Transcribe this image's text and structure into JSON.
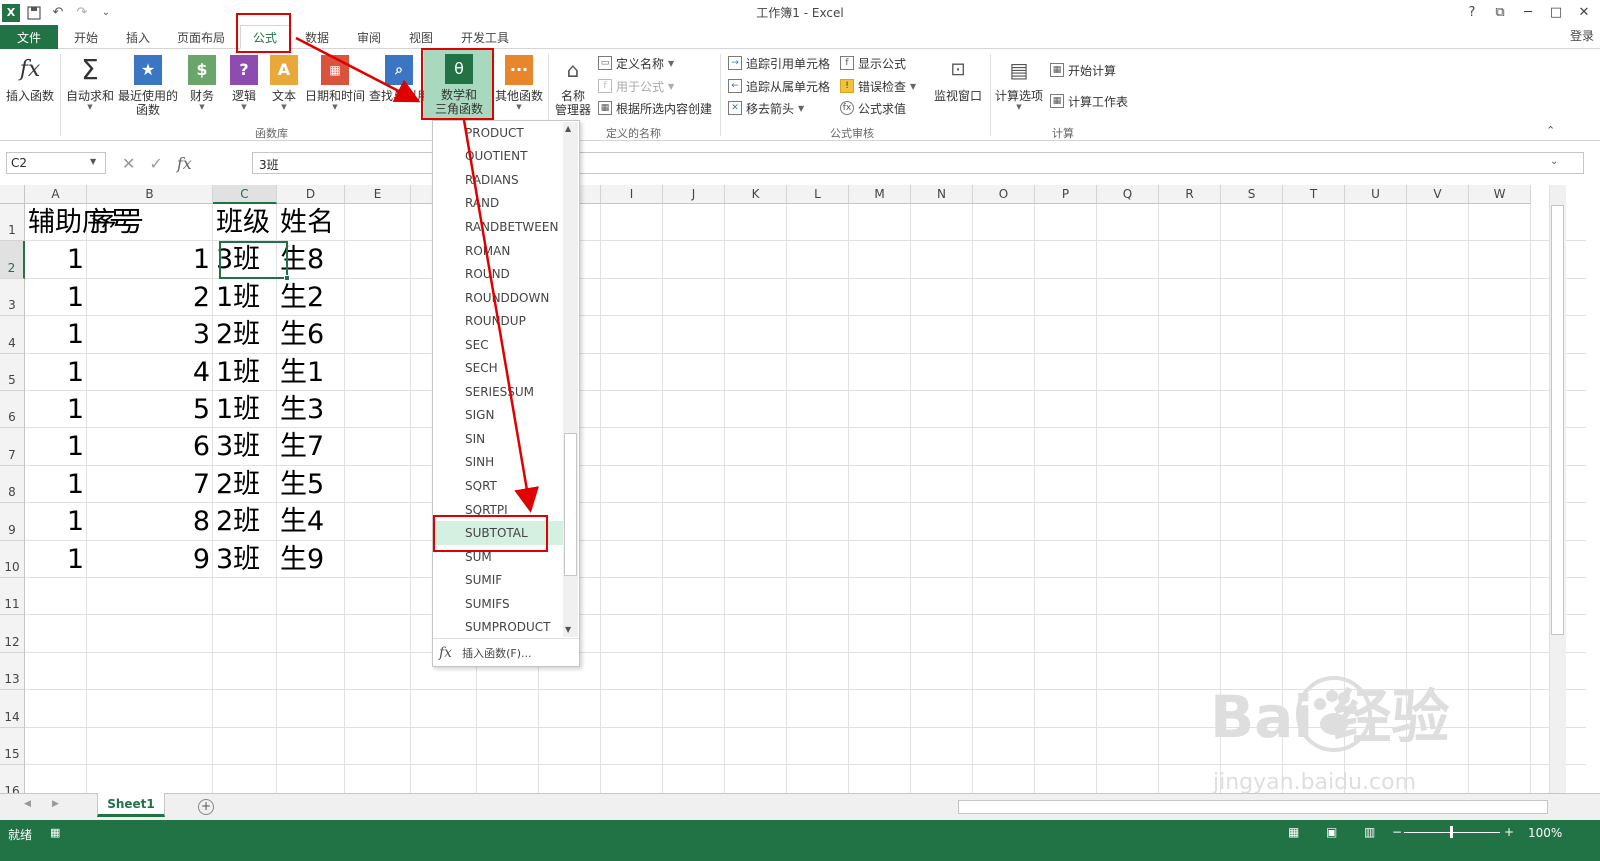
{
  "window": {
    "title": "工作簿1 - Excel",
    "login": "登录",
    "help": "?",
    "restore": "⧉",
    "min": "─",
    "max": "□",
    "close": "✕"
  },
  "qat": {
    "undo": "↶",
    "redo": "↷",
    "more": "⌄"
  },
  "tabs": {
    "file": "文件",
    "items": [
      "开始",
      "插入",
      "页面布局",
      "公式",
      "数据",
      "审阅",
      "视图",
      "开发工具"
    ],
    "active": "公式"
  },
  "ribbon": {
    "insert_function": "插入函数",
    "autosum": "自动求和",
    "recent": "最近使用的\n函数",
    "financial": "财务",
    "logical": "逻辑",
    "text": "文本",
    "datetime": "日期和时间",
    "lookup": "查找与引用",
    "math_line1": "数学和",
    "math_line2": "三角函数",
    "other": "其他函数",
    "group_library": "函数库",
    "name_mgr_line1": "名称",
    "name_mgr_line2": "管理器",
    "define_name": "定义名称",
    "use_in_formula": "用于公式",
    "create_from_sel": "根据所选内容创建",
    "group_names": "定义的名称",
    "trace_prec": "追踪引用单元格",
    "trace_dep": "追踪从属单元格",
    "remove_arrows": "移去箭头",
    "show_formulas": "显示公式",
    "error_check": "错误检查",
    "eval_formula": "公式求值",
    "group_audit": "公式审核",
    "watch": "监视窗口",
    "calc_options": "计算选项",
    "calc_now": "开始计算",
    "calc_sheet": "计算工作表",
    "group_calc": "计算"
  },
  "formula_bar": {
    "name_box": "C2",
    "formula": "3班",
    "fx": "fx"
  },
  "columns": [
    "A",
    "B",
    "C",
    "D",
    "E",
    "F",
    "G",
    "H",
    "I",
    "J",
    "K",
    "L",
    "M",
    "N",
    "O",
    "P",
    "Q",
    "R",
    "S",
    "T",
    "U",
    "V",
    "W"
  ],
  "rows": [
    "1",
    "2",
    "3",
    "4",
    "5",
    "6",
    "7",
    "8",
    "9",
    "10",
    "11",
    "12",
    "13",
    "14",
    "15",
    "16"
  ],
  "sheet": {
    "header": [
      "辅助序号",
      "序号",
      "班级",
      "姓名"
    ],
    "data": [
      [
        "1",
        "1",
        "3班",
        "生8"
      ],
      [
        "1",
        "2",
        "1班",
        "生2"
      ],
      [
        "1",
        "3",
        "2班",
        "生6"
      ],
      [
        "1",
        "4",
        "1班",
        "生1"
      ],
      [
        "1",
        "5",
        "1班",
        "生3"
      ],
      [
        "1",
        "6",
        "3班",
        "生7"
      ],
      [
        "1",
        "7",
        "2班",
        "生5"
      ],
      [
        "1",
        "8",
        "2班",
        "生4"
      ],
      [
        "1",
        "9",
        "3班",
        "生9"
      ]
    ]
  },
  "dropdown": {
    "items": [
      "PRODUCT",
      "QUOTIENT",
      "RADIANS",
      "RAND",
      "RANDBETWEEN",
      "ROMAN",
      "ROUND",
      "ROUNDDOWN",
      "ROUNDUP",
      "SEC",
      "SECH",
      "SERIESSUM",
      "SIGN",
      "SIN",
      "SINH",
      "SQRT",
      "SQRTPI",
      "SUBTOTAL",
      "SUM",
      "SUMIF",
      "SUMIFS",
      "SUMPRODUCT"
    ],
    "highlighted": "SUBTOTAL",
    "insert_function": "插入函数(F)..."
  },
  "sheet_tabs": {
    "active": "Sheet1",
    "add": "+"
  },
  "status": {
    "ready": "就绪",
    "zoom": "100%"
  },
  "watermark": {
    "brand": "Bai  经验",
    "url": "jingyan.baidu.com"
  },
  "colors": {
    "excel_green": "#217346",
    "highlight": "#d3f0e0",
    "annotation_red": "#e00000"
  }
}
